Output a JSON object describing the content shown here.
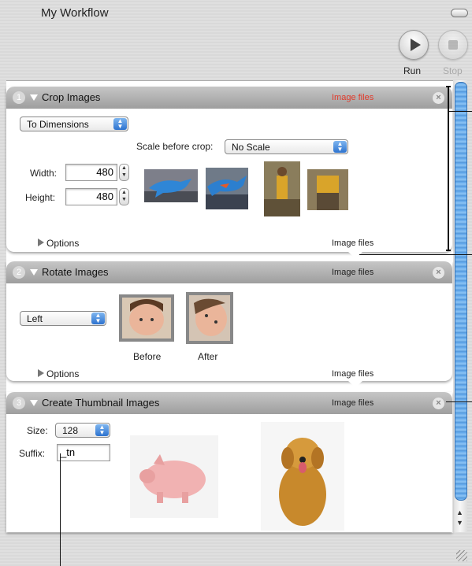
{
  "window": {
    "title": "My Workflow"
  },
  "toolbar": {
    "run_label": "Run",
    "stop_label": "Stop"
  },
  "actions": [
    {
      "number": "1",
      "title": "Crop Images",
      "header_type": "Image files",
      "mode_popup": "To Dimensions",
      "scale_label": "Scale before crop:",
      "scale_value": "No Scale",
      "width_label": "Width:",
      "width_value": "480",
      "height_label": "Height:",
      "height_value": "480",
      "options_label": "Options",
      "footer_type": "Image files"
    },
    {
      "number": "2",
      "title": "Rotate Images",
      "header_type": "Image files",
      "direction_value": "Left",
      "before_label": "Before",
      "after_label": "After",
      "options_label": "Options",
      "footer_type": "Image files"
    },
    {
      "number": "3",
      "title": "Create Thumbnail Images",
      "header_type": "Image files",
      "size_label": "Size:",
      "size_value": "128",
      "suffix_label": "Suffix:",
      "suffix_value": "_tn"
    }
  ],
  "colors": {
    "accent": "#3a8ee6",
    "warning_type": "#e23a2a",
    "header": "#b3b3b3"
  },
  "icons": [
    "run-icon",
    "stop-icon",
    "close-icon",
    "disclosure-triangle-icon"
  ]
}
